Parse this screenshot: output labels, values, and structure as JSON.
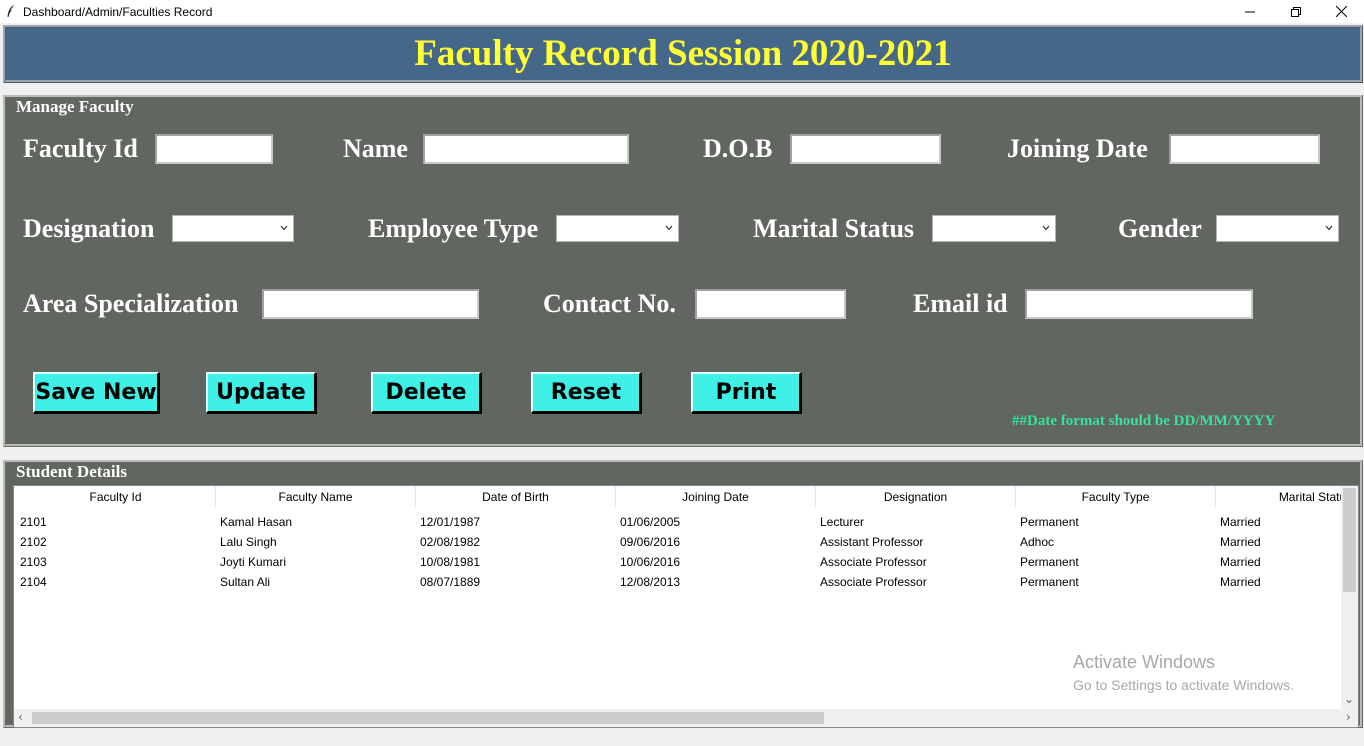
{
  "window": {
    "title": "Dashboard/Admin/Faculties Record"
  },
  "header": {
    "title": "Faculty Record Session 2020-2021"
  },
  "manage": {
    "legend": "Manage Faculty",
    "labels": {
      "faculty_id": "Faculty Id",
      "name": "Name",
      "dob": "D.O.B",
      "joining_date": "Joining Date",
      "designation": "Designation",
      "employee_type": "Employee Type",
      "marital_status": "Marital Status",
      "gender": "Gender",
      "area_specialization": "Area Specialization",
      "contact_no": "Contact No.",
      "email_id": "Email id"
    },
    "values": {
      "faculty_id": "",
      "name": "",
      "dob": "",
      "joining_date": "",
      "designation": "",
      "employee_type": "",
      "marital_status": "",
      "gender": "",
      "area_specialization": "",
      "contact_no": "",
      "email_id": ""
    },
    "buttons": {
      "save_new": "Save New",
      "update": "Update",
      "delete": "Delete",
      "reset": "Reset",
      "print": "Print"
    },
    "note": "##Date format should be DD/MM/YYYY"
  },
  "details": {
    "legend": "Student Details",
    "columns": [
      "Faculty Id",
      "Faculty Name",
      "Date of Birth",
      "Joining Date",
      "Designation",
      "Faculty Type",
      "Marital Status"
    ],
    "rows": [
      [
        "2101",
        "Kamal Hasan",
        "12/01/1987",
        "01/06/2005",
        "Lecturer",
        "Permanent",
        "Married"
      ],
      [
        "2102",
        "Lalu Singh",
        "02/08/1982",
        "09/06/2016",
        "Assistant Professor",
        "Adhoc",
        "Married"
      ],
      [
        "2103",
        "Joyti Kumari",
        "10/08/1981",
        "10/06/2016",
        "Associate Professor",
        "Permanent",
        "Married"
      ],
      [
        "2104",
        "Sultan Ali",
        "08/07/1889",
        "12/08/2013",
        "Associate Professor",
        "Permanent",
        "Married"
      ]
    ]
  },
  "watermark": {
    "line1": "Activate Windows",
    "line2": "Go to Settings to activate Windows."
  },
  "colors": {
    "banner": "#45688a",
    "title_text": "#ffff33",
    "panel": "#626660",
    "button": "#3ef0e6",
    "note": "#37e29c"
  },
  "icons": {
    "app": "feather-icon",
    "minimize": "minimize-icon",
    "restore": "restore-icon",
    "close": "close-icon",
    "dropdown": "chevron-down-icon"
  }
}
